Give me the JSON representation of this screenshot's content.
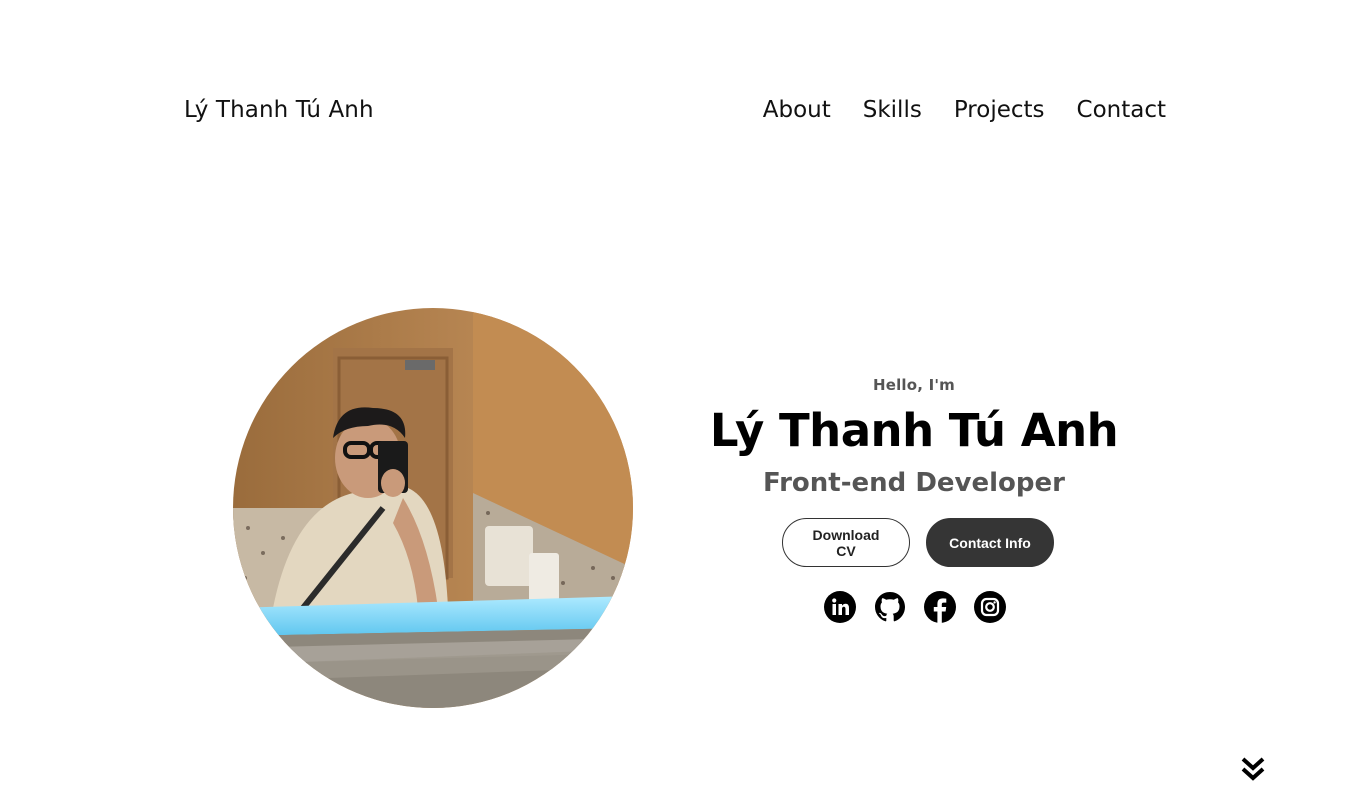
{
  "header": {
    "logo": "Lý Thanh Tú Anh",
    "nav": [
      {
        "label": "About"
      },
      {
        "label": "Skills"
      },
      {
        "label": "Projects"
      },
      {
        "label": "Contact"
      }
    ]
  },
  "hero": {
    "greeting": "Hello, I'm",
    "name": "Lý Thanh Tú Anh",
    "role": "Front-end Developer",
    "buttons": {
      "download": "Download CV",
      "contact": "Contact Info"
    },
    "socials": [
      {
        "icon": "linkedin-icon"
      },
      {
        "icon": "github-icon"
      },
      {
        "icon": "facebook-icon"
      },
      {
        "icon": "instagram-icon"
      }
    ],
    "photo": {
      "icon": "profile-photo"
    }
  },
  "scroll": {
    "icon": "double-chevron-down-icon"
  }
}
